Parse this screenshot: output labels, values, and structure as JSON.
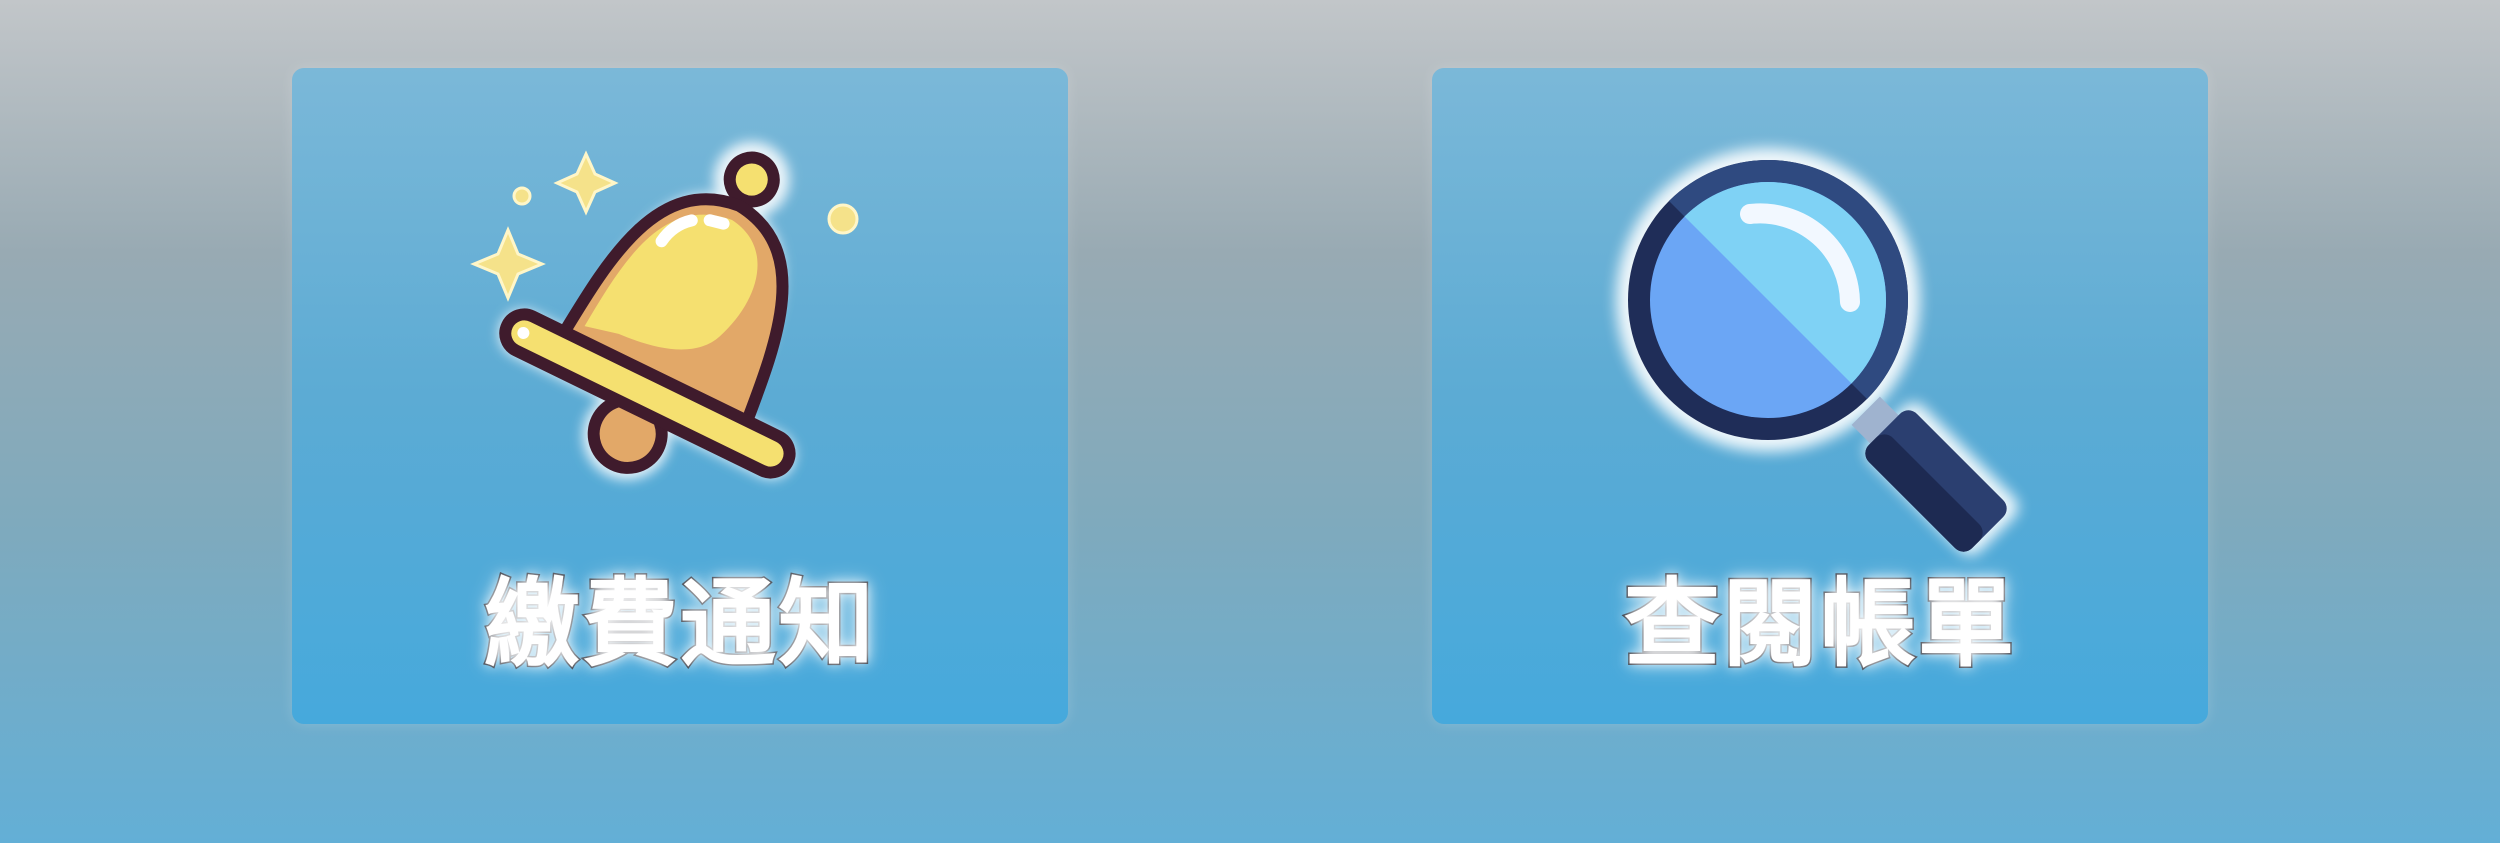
{
  "cards": [
    {
      "label": "繳費通知",
      "icon": "bell-icon",
      "color": "#f5e070"
    },
    {
      "label": "查閱帳單",
      "icon": "magnifier-icon",
      "color": "#6ba6f5"
    }
  ]
}
